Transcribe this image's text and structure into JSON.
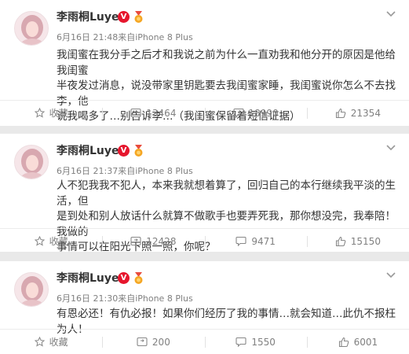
{
  "posts": [
    {
      "author": "李雨桐Luyee",
      "meta": "6月16日 21:48来自iPhone 8 Plus",
      "lines": [
        "我闺蜜在我分手之后才和我说之前为什么一直劝我和他分开的原因是他给我闺蜜",
        "半夜发过消息，说没带家里钥匙要去我闺蜜家睡，我闺蜜说你怎么不去找李，他",
        "说我喝多了…别告诉李…（我闺蜜保留着短信证据）"
      ],
      "fav_label": "收藏",
      "reposts": "13464",
      "comments": "18990",
      "likes": "21354"
    },
    {
      "author": "李雨桐Luyee",
      "meta": "6月16日 21:37来自iPhone 8 Plus",
      "lines": [
        "人不犯我我不犯人，本来我就想着算了，回归自己的本行继续我平淡的生活，但",
        "是到处和别人放话什么就算不做歌手也要弄死我，那你想没完，我奉陪！我做的",
        "事情可以在阳光下照一照，你呢？"
      ],
      "fav_label": "收藏",
      "reposts": "12428",
      "comments": "9471",
      "likes": "15150"
    },
    {
      "author": "李雨桐Luyee",
      "meta": "6月16日 21:30来自iPhone 8 Plus",
      "lines": [
        "有恩必还！有仇必报！如果你们经历了我的事情…就会知道…此仇不报枉为人！"
      ],
      "fav_label": "收藏",
      "reposts": "200",
      "comments": "1550",
      "likes": "6001"
    }
  ],
  "icons": {
    "verified": "v-badge-icon",
    "medal": "medal-icon",
    "menu": "chevron-down-icon",
    "favorite": "star-icon",
    "repost": "repost-icon",
    "comment": "comment-icon",
    "like": "thumbs-up-icon"
  },
  "colors": {
    "verified": "#e6162d",
    "medal": "#f5a623",
    "background": "#e9e9e9",
    "meta_text": "#808080"
  }
}
